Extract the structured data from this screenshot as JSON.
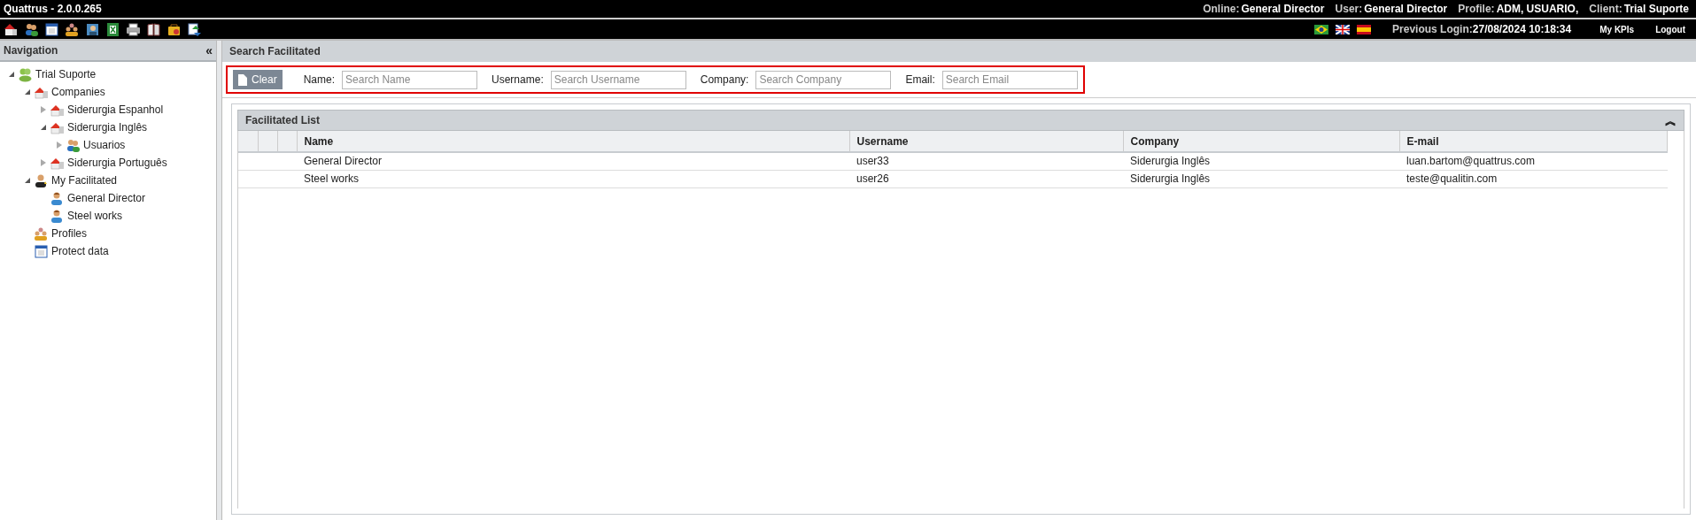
{
  "window": {
    "title": "Quattrus - 2.0.0.265"
  },
  "session": [
    {
      "label": "Online:",
      "value": "General Director"
    },
    {
      "label": "User:",
      "value": "General Director"
    },
    {
      "label": "Profile:",
      "value": "ADM, USUARIO,"
    },
    {
      "label": "Client:",
      "value": "Trial Suporte"
    }
  ],
  "previous_login": {
    "label": "Previous Login:",
    "value": "27/08/2024 10:18:34"
  },
  "top_links": [
    "My KPIs",
    "Logout"
  ],
  "navigation": {
    "title": "Navigation",
    "collapse": "«",
    "tree": [
      {
        "label": "Trial Suporte",
        "kind": "group",
        "expanded": true,
        "children": [
          {
            "label": "Companies",
            "kind": "company",
            "expanded": true,
            "children": [
              {
                "label": "Siderurgia Espanhol",
                "kind": "company",
                "expanded": false
              },
              {
                "label": "Siderurgia Inglês",
                "kind": "company",
                "expanded": true,
                "children": [
                  {
                    "label": "Usuarios",
                    "kind": "users",
                    "expanded": false
                  }
                ]
              },
              {
                "label": "Siderurgia Português",
                "kind": "company",
                "expanded": false
              }
            ]
          },
          {
            "label": "My Facilitated",
            "kind": "manager",
            "expanded": true,
            "children": [
              {
                "label": "General Director",
                "kind": "person"
              },
              {
                "label": "Steel works",
                "kind": "person"
              }
            ]
          },
          {
            "label": "Profiles",
            "kind": "profiles"
          },
          {
            "label": "Protect data",
            "kind": "calendar"
          }
        ]
      }
    ]
  },
  "search": {
    "title": "Search Facilitated",
    "clear_button": "Clear",
    "fields": [
      {
        "label": "Name:",
        "placeholder": "Search Name"
      },
      {
        "label": "Username:",
        "placeholder": "Search Username"
      },
      {
        "label": "Company:",
        "placeholder": "Search Company"
      },
      {
        "label": "Email:",
        "placeholder": "Search Email"
      }
    ]
  },
  "list": {
    "title": "Facilitated List",
    "collapse": "︽",
    "columns": [
      "Name",
      "Username",
      "Company",
      "E-mail"
    ],
    "rows": [
      [
        "General Director",
        "user33",
        "Siderurgia Inglês",
        "luan.bartom@quattrus.com"
      ],
      [
        "Steel works",
        "user26",
        "Siderurgia Inglês",
        "teste@qualitin.com"
      ]
    ]
  }
}
